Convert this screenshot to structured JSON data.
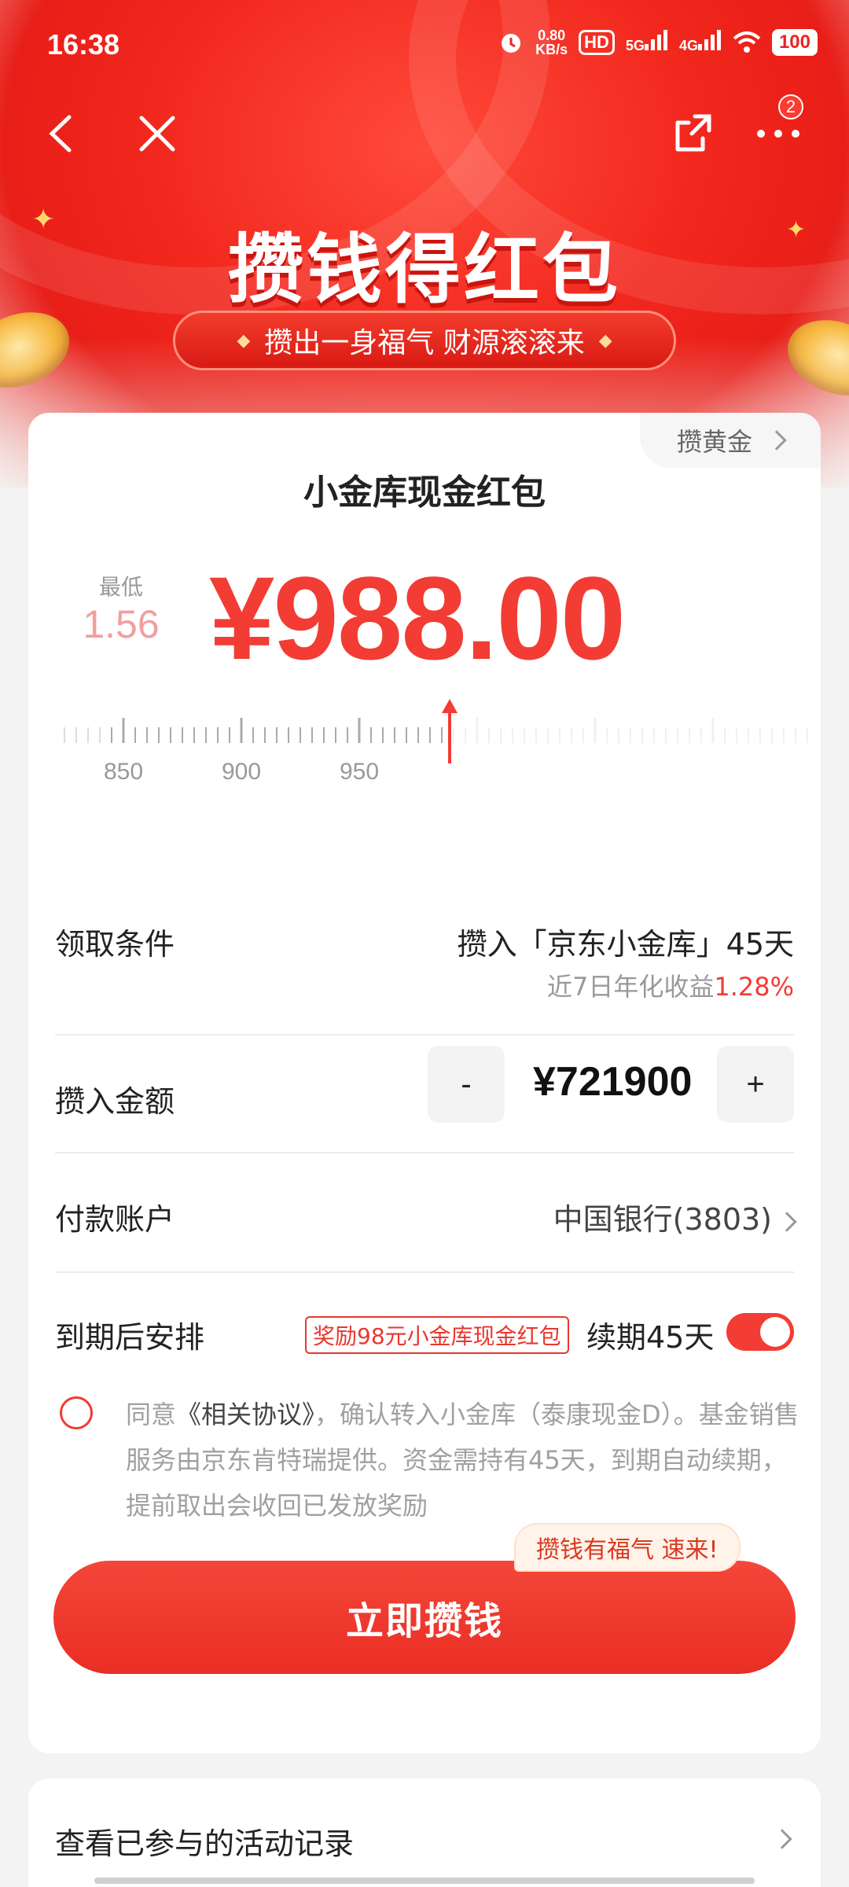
{
  "status_bar": {
    "time": "16:38",
    "net_speed": "0.80\nKB/s",
    "hd_label": "HD",
    "sim1": "5G",
    "sim2": "4G",
    "battery": "100"
  },
  "nav": {
    "menu_badge": "2"
  },
  "hero": {
    "title": "攒钱得红包",
    "subtitle": "攒出一身福气 财源滚滚来"
  },
  "card": {
    "gold_tag": "攒黄金",
    "title": "小金库现金红包",
    "min_label": "最低",
    "min_value": "1.56",
    "amount": "¥988.00",
    "ruler_labels": [
      "850",
      "900",
      "950"
    ]
  },
  "conditions": {
    "label": "领取条件",
    "value": "攒入「京东小金库」45天",
    "yield_prefix": "近7日年化收益",
    "yield_value": "1.28%"
  },
  "deposit": {
    "label": "攒入金额",
    "minus": "-",
    "plus": "+",
    "value": "¥721900"
  },
  "account": {
    "label": "付款账户",
    "value": "中国银行(3803)"
  },
  "maturity": {
    "label": "到期后安排",
    "promo": "奖励98元小金库现金红包",
    "renew": "续期45天",
    "toggle_on": true
  },
  "agreement": {
    "prefix": "同意",
    "link": "《相关协议》",
    "rest": "，确认转入小金库（泰康现金D）。基金销售服务由京东肯特瑞提供。资金需持有45天，到期自动续期，提前取出会收回已发放奖励"
  },
  "cta": {
    "label": "立即攒钱",
    "bubble": "攒钱有福气 速来!"
  },
  "history": {
    "label": "查看已参与的活动记录"
  },
  "colors": {
    "brand_red": "#f23c34",
    "hero_red": "#e81e18"
  }
}
